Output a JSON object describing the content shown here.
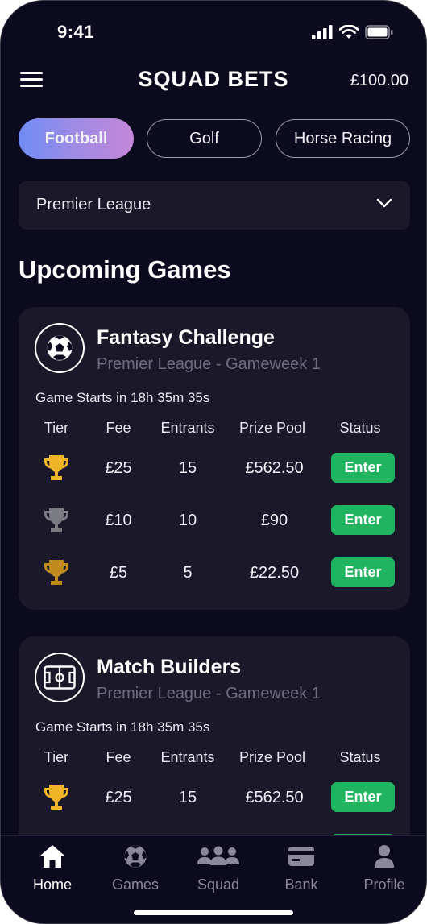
{
  "status_bar": {
    "time": "9:41"
  },
  "header": {
    "title": "SQUAD BETS",
    "balance": "£100.00"
  },
  "sport_tabs": [
    {
      "label": "Football",
      "active": true
    },
    {
      "label": "Golf",
      "active": false
    },
    {
      "label": "Horse Racing",
      "active": false
    }
  ],
  "league_select": {
    "value": "Premier League"
  },
  "section_title": "Upcoming Games",
  "columns": {
    "tier": "Tier",
    "fee": "Fee",
    "entrants": "Entrants",
    "prize_pool": "Prize Pool",
    "status": "Status"
  },
  "games": [
    {
      "title": "Fantasy Challenge",
      "subtitle": "Premier League - Gameweek 1",
      "starts": "Game Starts in 18h 35m 35s",
      "icon": "soccer-ball-icon",
      "rows": [
        {
          "tier": "gold",
          "fee": "£25",
          "entrants": "15",
          "prize": "£562.50",
          "action": "Enter"
        },
        {
          "tier": "silver",
          "fee": "£10",
          "entrants": "10",
          "prize": "£90",
          "action": "Enter"
        },
        {
          "tier": "bronze",
          "fee": "£5",
          "entrants": "5",
          "prize": "£22.50",
          "action": "Enter"
        }
      ]
    },
    {
      "title": "Match Builders",
      "subtitle": "Premier League - Gameweek 1",
      "starts": "Game Starts in 18h 35m 35s",
      "icon": "pitch-icon",
      "rows": [
        {
          "tier": "gold",
          "fee": "£25",
          "entrants": "15",
          "prize": "£562.50",
          "action": "Enter"
        }
      ]
    }
  ],
  "nav": [
    {
      "label": "Home",
      "icon": "home-icon",
      "active": true
    },
    {
      "label": "Games",
      "icon": "games-icon",
      "active": false
    },
    {
      "label": "Squad",
      "icon": "squad-icon",
      "active": false
    },
    {
      "label": "Bank",
      "icon": "bank-icon",
      "active": false
    },
    {
      "label": "Profile",
      "icon": "profile-icon",
      "active": false
    }
  ],
  "colors": {
    "background": "#0c0a1e",
    "card": "#1a1829",
    "enter_button": "#21b460",
    "trophy_gold": "#f0b429",
    "trophy_silver": "#7a7a82",
    "trophy_bronze": "#c08a1e",
    "tab_gradient_start": "#6f8cf5",
    "tab_gradient_end": "#c487d8"
  }
}
